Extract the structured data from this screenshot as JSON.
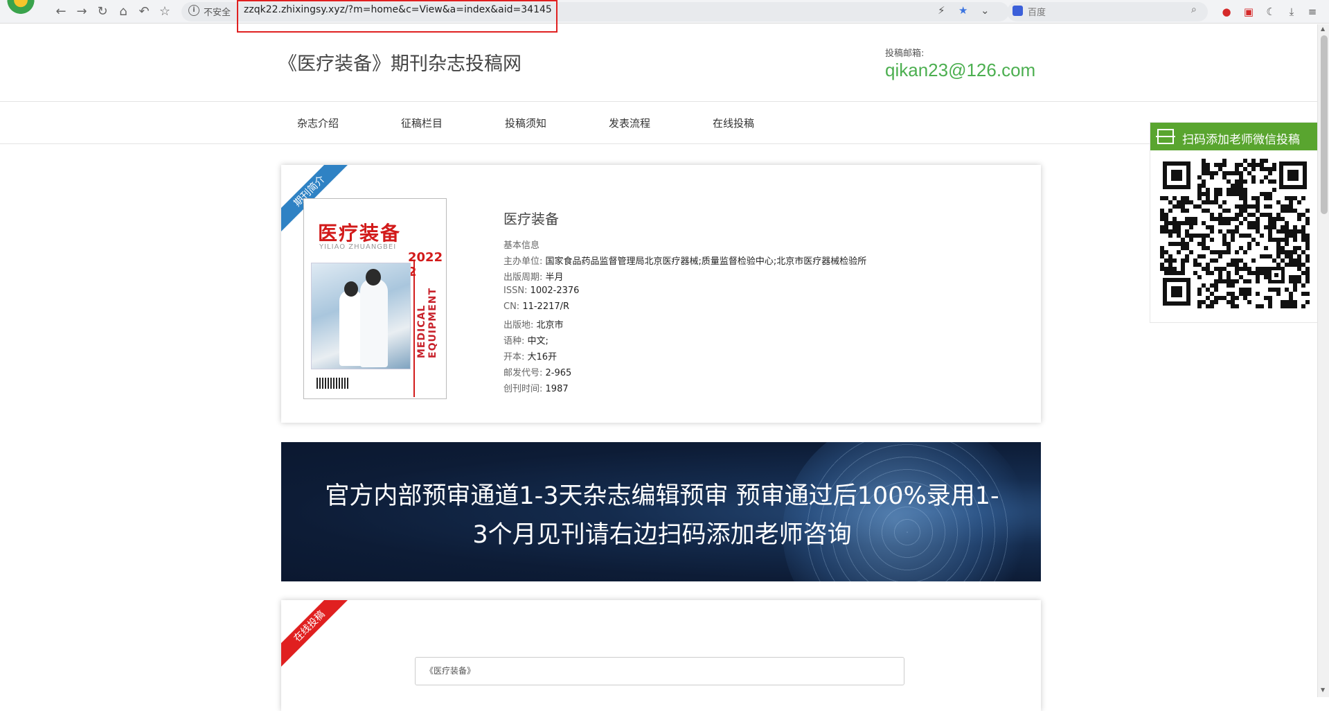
{
  "browser": {
    "url": "zzqk22.zhixingsy.xyz/?m=home&c=View&a=index&aid=34145",
    "insecure_label": "不安全",
    "search_placeholder": "百度"
  },
  "site": {
    "title": "《医疗装备》期刊杂志投稿网",
    "email_label": "投稿邮箱:",
    "email": "qikan23@126.com"
  },
  "nav": {
    "items": [
      {
        "label": "杂志介绍"
      },
      {
        "label": "征稿栏目"
      },
      {
        "label": "投稿须知"
      },
      {
        "label": "发表流程"
      },
      {
        "label": "在线投稿"
      }
    ]
  },
  "intro_card": {
    "ribbon": "期刊简介",
    "cover": {
      "title": "医疗装备",
      "subtitle": "YILIAO ZHUANGBEI",
      "year_issue": "2022 2",
      "vertical_text": "MEDICAL EQUIPMENT"
    },
    "name": "医疗装备",
    "section": "基本信息",
    "fields": [
      {
        "label": "主办单位:",
        "value": "国家食品药品监督管理局北京医疗器械;质量监督检验中心;北京市医疗器械检验所"
      },
      {
        "label": "出版周期:",
        "value": "半月"
      },
      {
        "label": "ISSN:",
        "value": "1002-2376"
      },
      {
        "label": "CN:",
        "value": "11-2217/R"
      },
      {
        "label": "出版地:",
        "value": "北京市"
      },
      {
        "label": "语种:",
        "value": "中文;"
      },
      {
        "label": "开本:",
        "value": "大16开"
      },
      {
        "label": "邮发代号:",
        "value": "2-965"
      },
      {
        "label": "创刊时间:",
        "value": "1987"
      }
    ]
  },
  "banner": {
    "text_line1": "官方内部预审通道1-3天杂志编辑预审 预审通过后100%录用1-",
    "text_line2": "3个月见刊请右边扫码添加老师咨询"
  },
  "submit_card": {
    "ribbon": "在线投稿",
    "journal_field_value": "《医疗装备》"
  },
  "qr_panel": {
    "title": "扫码添加老师微信投稿"
  },
  "colors": {
    "accent_green": "#59a52f",
    "email_green": "#4caf50",
    "ribbon_blue": "#2f82c4",
    "ribbon_red": "#e02020"
  }
}
